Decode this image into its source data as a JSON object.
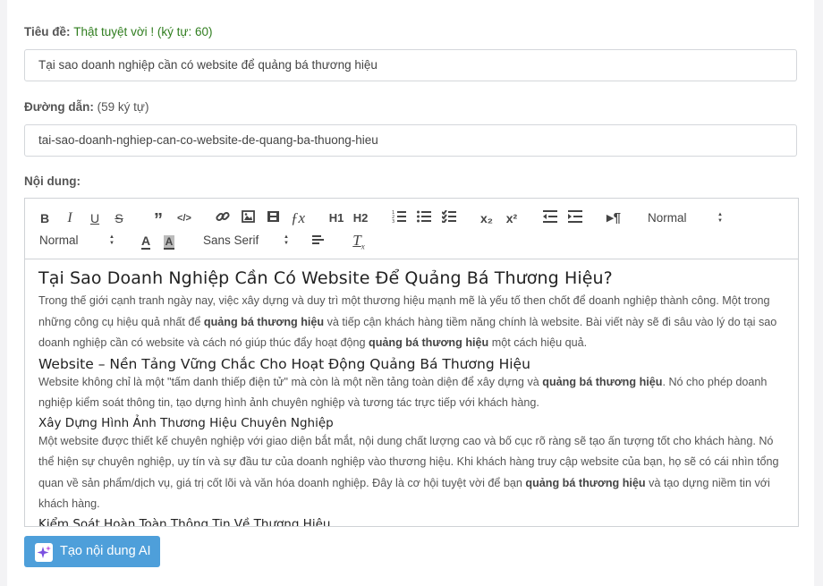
{
  "title_field": {
    "label": "Tiêu đề:",
    "status": "Thật tuyệt vời ! (ký tự: 60)",
    "value": "Tại sao doanh nghiệp cần có website để quảng bá thương hiệu"
  },
  "slug_field": {
    "label": "Đường dẫn:",
    "count": "(59 ký tự)",
    "value": "tai-sao-doanh-nghiep-can-co-website-de-quang-ba-thuong-hieu"
  },
  "content_label": "Nội dung:",
  "toolbar": {
    "header_select": "Normal",
    "size_select": "Normal",
    "font_select": "Sans Serif",
    "h1": "H1",
    "h2": "H2",
    "subscript": "x₂",
    "superscript": "x²"
  },
  "content": {
    "h1": "Tại Sao Doanh Nghiệp Cần Có Website Để Quảng Bá Thương Hiệu?",
    "p1_a": "Trong thế giới cạnh tranh ngày nay, việc xây dựng và duy trì một thương hiệu mạnh mẽ là yếu tố then chốt để doanh nghiệp thành công. Một trong những công cụ hiệu quả nhất để ",
    "p1_b1": "quảng bá thương hiệu",
    "p1_c": " và tiếp cận khách hàng tiềm năng chính là website. Bài viết này sẽ đi sâu vào lý do tại sao doanh nghiệp cần có website và cách nó giúp thúc đẩy hoạt động ",
    "p1_b2": "quảng bá thương hiệu",
    "p1_d": " một cách hiệu quả.",
    "h2": "Website – Nền Tảng Vững Chắc Cho Hoạt Động Quảng Bá Thương Hiệu",
    "p2_a": "Website không chỉ là một \"tấm danh thiếp điện tử\" mà còn là một nền tảng toàn diện để xây dựng và ",
    "p2_b": "quảng bá thương hiệu",
    "p2_c": ". Nó cho phép doanh nghiệp kiểm soát thông tin, tạo dựng hình ảnh chuyên nghiệp và tương tác trực tiếp với khách hàng.",
    "h3_1": "Xây Dựng Hình Ảnh Thương Hiệu Chuyên Nghiệp",
    "p3_a": "Một website được thiết kế chuyên nghiệp với giao diện bắt mắt, nội dung chất lượng cao và bố cục rõ ràng sẽ tạo ấn tượng tốt cho khách hàng. Nó thể hiện sự chuyên nghiệp, uy tín và sự đầu tư của doanh nghiệp vào thương hiệu. Khi khách hàng truy cập website của bạn, họ sẽ có cái nhìn tổng quan về sản phẩm/dịch vụ, giá trị cốt lõi và văn hóa doanh nghiệp. Đây là cơ hội tuyệt vời để bạn ",
    "p3_b": "quảng bá thương hiệu",
    "p3_c": " và tạo dựng niềm tin với khách hàng.",
    "h3_2": "Kiểm Soát Hoàn Toàn Thông Tin Về Thương Hiệu"
  },
  "ai_button": "Tạo nội dung AI"
}
